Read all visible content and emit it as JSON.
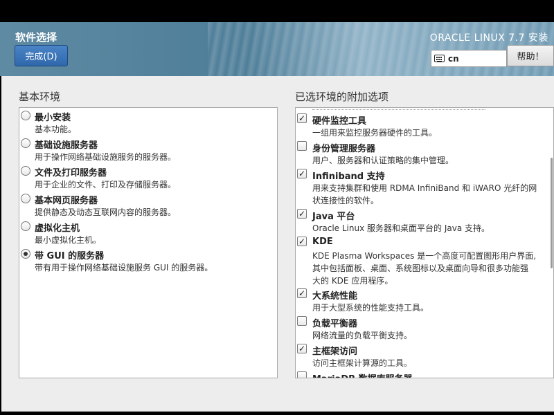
{
  "header": {
    "page_title": "软件选择",
    "done_label": "完成(D)",
    "product_title": "ORACLE LINUX 7.7 安装",
    "keyboard_layout": "cn",
    "help_label": "帮助！"
  },
  "base_environment": {
    "label": "基本环境",
    "items": [
      {
        "title": "最小安装",
        "desc": "基本功能。",
        "selected": false
      },
      {
        "title": "基础设施服务器",
        "desc": "用于操作网络基础设施服务的服务器。",
        "selected": false
      },
      {
        "title": "文件及打印服务器",
        "desc": "用于企业的文件、打印及存储服务器。",
        "selected": false
      },
      {
        "title": "基本网页服务器",
        "desc": "提供静态及动态互联网内容的服务器。",
        "selected": false
      },
      {
        "title": "虚拟化主机",
        "desc": "最小虚拟化主机。",
        "selected": false
      },
      {
        "title": "带 GUI 的服务器",
        "desc": "带有用于操作网络基础设施服务 GUI 的服务器。",
        "selected": true
      }
    ]
  },
  "addons": {
    "label": "已选环境的附加选项",
    "items": [
      {
        "title": "硬件监控工具",
        "desc": [
          "一组用来监控服务器硬件的工具。"
        ],
        "checked": true
      },
      {
        "title": "身份管理服务器",
        "desc": [
          "用户、服务器和认证策略的集中管理。"
        ],
        "checked": false
      },
      {
        "title": "Infiniband 支持",
        "desc": [
          "用来支持集群和使用 RDMA InfiniBand 和 iWARO 光纤的网",
          "状连接性的软件。"
        ],
        "checked": true
      },
      {
        "title": "Java 平台",
        "desc": [
          "Oracle Linux 服务器和桌面平台的 Java 支持。"
        ],
        "checked": true
      },
      {
        "title": "KDE",
        "desc": [
          " KDE Plasma Workspaces 是一个高度可配置图形用户界面,",
          "其中包括面板、桌面、系统图标以及桌面向导和很多功能强",
          "大的 KDE 应用程序。"
        ],
        "checked": true
      },
      {
        "title": "大系统性能",
        "desc": [
          "用于大型系统的性能支持工具。"
        ],
        "checked": true
      },
      {
        "title": "负载平衡器",
        "desc": [
          "网络流量的负载平衡支持。"
        ],
        "checked": false
      },
      {
        "title": "主框架访问",
        "desc": [
          "访问主框架计算源的工具。"
        ],
        "checked": true
      },
      {
        "title": "MariaDB 数据库服务器",
        "desc": [],
        "checked": false
      }
    ]
  }
}
